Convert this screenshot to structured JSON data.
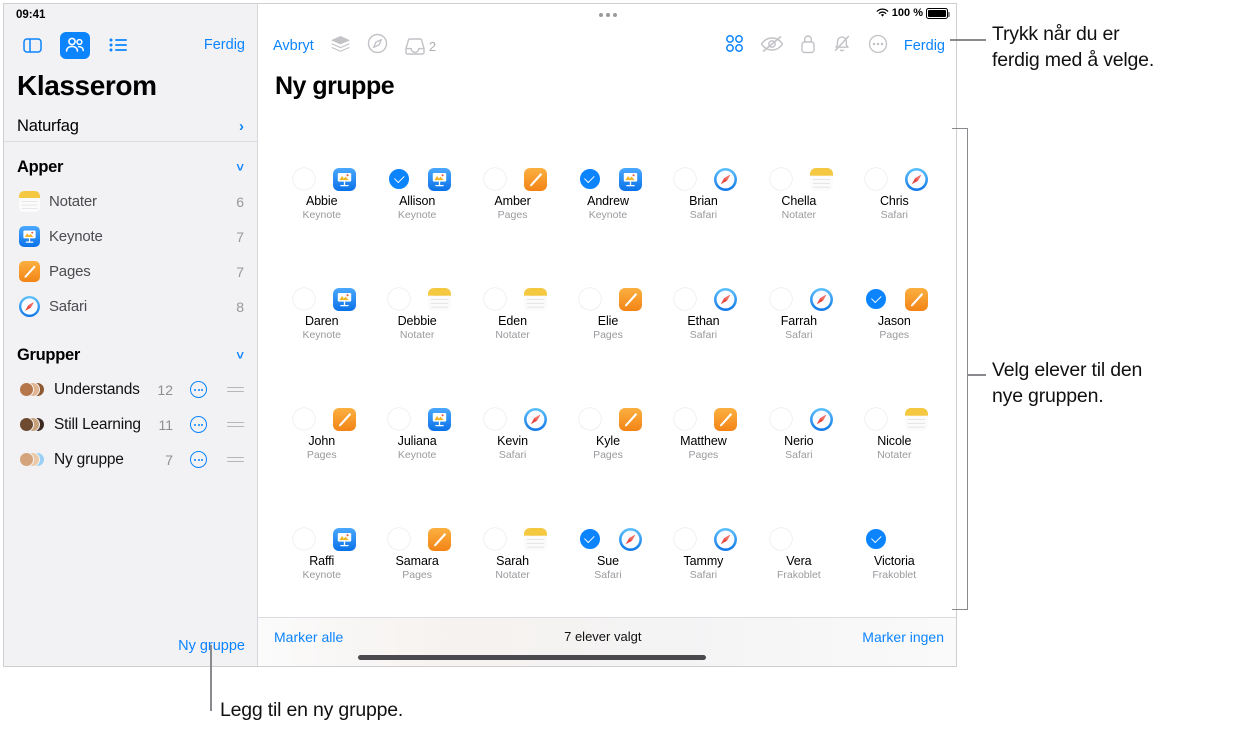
{
  "sidebar": {
    "status_time": "09:41",
    "toolbar": {
      "sidebar_icon": "sidebar-icon",
      "people_icon": "people-icon",
      "list_icon": "list-icon",
      "done_label": "Ferdig"
    },
    "title": "Klasserom",
    "subject": "Naturfag",
    "apps_header": "Apper",
    "apps": [
      {
        "name": "Notater",
        "count": "6",
        "icon": "notes-icon"
      },
      {
        "name": "Keynote",
        "count": "7",
        "icon": "keynote-icon"
      },
      {
        "name": "Pages",
        "count": "7",
        "icon": "pages-icon"
      },
      {
        "name": "Safari",
        "count": "8",
        "icon": "safari-icon"
      }
    ],
    "groups_header": "Grupper",
    "groups": [
      {
        "name": "Understands",
        "count": "12"
      },
      {
        "name": "Still Learning",
        "count": "11"
      },
      {
        "name": "Ny gruppe",
        "count": "7"
      }
    ],
    "new_group_label": "Ny gruppe"
  },
  "main": {
    "status": {
      "wifi": "wifi-icon",
      "battery_pct": "100 %"
    },
    "toolbar": {
      "cancel_label": "Avbryt",
      "layers_icon": "layers-icon",
      "navigate_icon": "navigate-icon",
      "inbox_icon": "inbox-icon",
      "inbox_count": "2",
      "grid_icon": "grid-view-icon",
      "hide_icon": "eye-slash-icon",
      "lock_icon": "lock-icon",
      "mute_icon": "bell-slash-icon",
      "more_icon": "ellipsis-circle-icon",
      "done_label": "Ferdig"
    },
    "title": "Ny gruppe",
    "bottom": {
      "select_all": "Marker alle",
      "status": "7 elever valgt",
      "select_none": "Marker ingen"
    },
    "students": [
      {
        "name": "Abbie",
        "app": "Keynote",
        "selected": false,
        "badge": "keynote",
        "skin": "#c99272",
        "hair": "#412a20",
        "bg": "#9fb68a"
      },
      {
        "name": "Allison",
        "app": "Keynote",
        "selected": true,
        "badge": "keynote",
        "skin": "#f0cfb6",
        "hair": "#b5522a",
        "bg": "#b9cfdc"
      },
      {
        "name": "Amber",
        "app": "Pages",
        "selected": false,
        "badge": "pages",
        "skin": "#e3b793",
        "hair": "#2f2118",
        "bg": "#6d7f8e"
      },
      {
        "name": "Andrew",
        "app": "Keynote",
        "selected": true,
        "badge": "keynote",
        "skin": "#d8a87e",
        "hair": "#7b7a78",
        "bg": "#cfd6d8"
      },
      {
        "name": "Brian",
        "app": "Safari",
        "selected": false,
        "badge": "safari",
        "skin": "#eec6a3",
        "hair": "#4a2f1d",
        "bg": "#33231a"
      },
      {
        "name": "Chella",
        "app": "Notater",
        "selected": false,
        "badge": "notes",
        "skin": "#d9a47e",
        "hair": "#2e1d14",
        "bg": "#b7bfb4"
      },
      {
        "name": "Chris",
        "app": "Safari",
        "selected": false,
        "badge": "safari",
        "skin": "#b0764f",
        "hair": "#241610",
        "bg": "#2d6a63"
      },
      {
        "name": "Daren",
        "app": "Keynote",
        "selected": false,
        "badge": "keynote",
        "skin": "#d09a72",
        "hair": "#1d1410",
        "bg": "#7e9a6b"
      },
      {
        "name": "Debbie",
        "app": "Notater",
        "selected": false,
        "badge": "notes",
        "skin": "#e4b592",
        "hair": "#3a2a1e",
        "bg": "#5a6270"
      },
      {
        "name": "Eden",
        "app": "Notater",
        "selected": false,
        "badge": "notes",
        "skin": "#b37a50",
        "hair": "#201410",
        "bg": "#e6e2dc"
      },
      {
        "name": "Elie",
        "app": "Pages",
        "selected": false,
        "badge": "pages",
        "skin": "#e8bd99",
        "hair": "#6a4428",
        "bg": "#8aa86c"
      },
      {
        "name": "Ethan",
        "app": "Safari",
        "selected": false,
        "badge": "safari",
        "skin": "#d8a77e",
        "hair": "#33211a",
        "bg": "#6e8f56"
      },
      {
        "name": "Farrah",
        "app": "Safari",
        "selected": false,
        "badge": "safari",
        "skin": "#dda97f",
        "hair": "#2b1b13",
        "bg": "#d6d6dc"
      },
      {
        "name": "Jason",
        "app": "Pages",
        "selected": true,
        "badge": "pages",
        "skin": "#8a5630",
        "hair": "#150d0a",
        "bg": "#2a2b2f"
      },
      {
        "name": "John",
        "app": "Pages",
        "selected": false,
        "badge": "pages",
        "skin": "#e0b28d",
        "hair": "#4a3324",
        "bg": "#c4ab8d"
      },
      {
        "name": "Juliana",
        "app": "Keynote",
        "selected": false,
        "badge": "keynote",
        "skin": "#f2cdb0",
        "hair": "#c06a33",
        "bg": "#dcdcdf"
      },
      {
        "name": "Kevin",
        "app": "Safari",
        "selected": false,
        "badge": "safari",
        "skin": "#e5bb95",
        "hair": "#a8793f",
        "bg": "#7e9a73"
      },
      {
        "name": "Kyle",
        "app": "Pages",
        "selected": false,
        "badge": "pages",
        "skin": "#dcae84",
        "hair": "#221712",
        "bg": "#dfd2b2"
      },
      {
        "name": "Matthew",
        "app": "Pages",
        "selected": false,
        "badge": "pages",
        "skin": "#d8a57e",
        "hair": "#9b7045",
        "bg": "#c6b49a"
      },
      {
        "name": "Nerio",
        "app": "Safari",
        "selected": false,
        "badge": "safari",
        "skin": "#9a6340",
        "hair": "#b9a079",
        "bg": "#4e7a4a"
      },
      {
        "name": "Nicole",
        "app": "Notater",
        "selected": false,
        "badge": "notes",
        "skin": "#6f4426",
        "hair": "#1a1110",
        "bg": "#5d5a69"
      },
      {
        "name": "Raffi",
        "app": "Keynote",
        "selected": false,
        "badge": "keynote",
        "skin": "#9c6440",
        "hair": "#241611",
        "bg": "#cfd9dd"
      },
      {
        "name": "Samara",
        "app": "Pages",
        "selected": false,
        "badge": "pages",
        "skin": "#d2a37c",
        "hair": "#221610",
        "bg": "#c8b49a"
      },
      {
        "name": "Sarah",
        "app": "Notater",
        "selected": false,
        "badge": "notes",
        "skin": "#6b3f24",
        "hair": "#100b09",
        "bg": "#eeeef1"
      },
      {
        "name": "Sue",
        "app": "Safari",
        "selected": true,
        "badge": "safari",
        "skin": "#ecc5a0",
        "hair": "#b58a4c",
        "bg": "#8ba37c"
      },
      {
        "name": "Tammy",
        "app": "Safari",
        "selected": false,
        "badge": "safari",
        "skin": "#cf9d75",
        "hair": "#2c1c14",
        "bg": "#cfcfd4"
      },
      {
        "name": "Vera",
        "app": "Frakoblet",
        "selected": false,
        "badge": "none",
        "skin": "#f0d0b6",
        "hair": "#d8bf94",
        "bg": "#dfe4e9"
      },
      {
        "name": "Victoria",
        "app": "Frakoblet",
        "selected": true,
        "badge": "none",
        "skin": "#8e5a36",
        "hair": "#1c1110",
        "bg": "#4d4754"
      }
    ]
  },
  "callouts": {
    "top_right": "Trykk når du er\nferdig med å velge.",
    "mid_right": "Velg elever til den\nnye gruppen.",
    "bottom": "Legg til en ny gruppe."
  },
  "colors": {
    "accent": "#0b84fe",
    "sidebar_bg": "#f2f2f5",
    "muted": "#9a9a9f"
  }
}
